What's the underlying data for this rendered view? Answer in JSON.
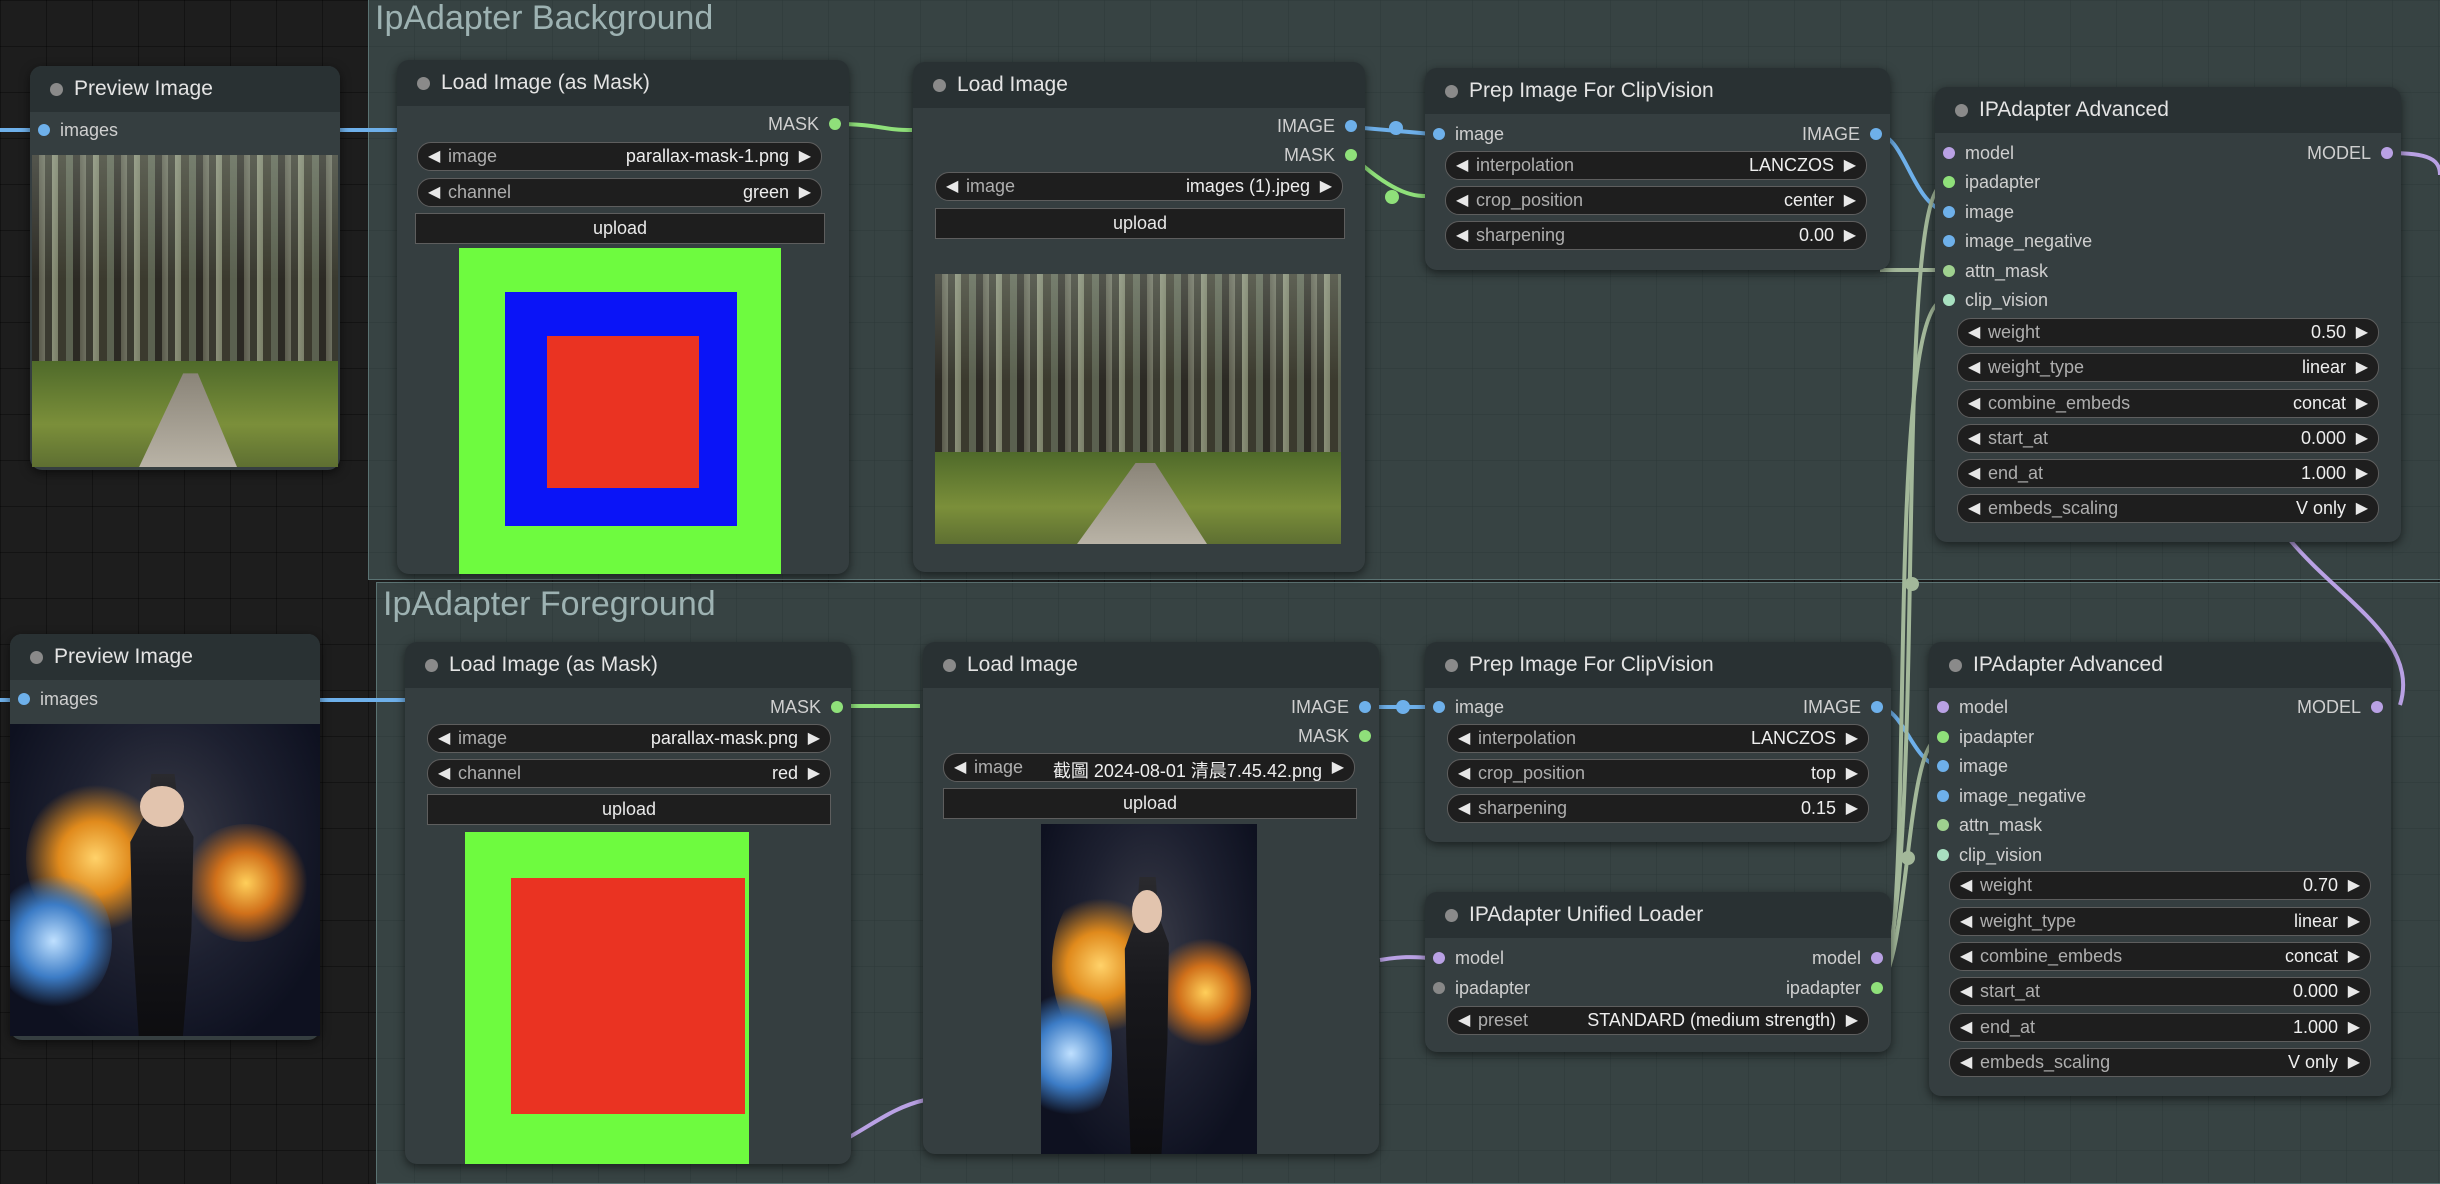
{
  "colors": {
    "image_wire": "#6eb0ea",
    "mask_wire": "#8fe07a",
    "model_wire": "#b9a1e4",
    "clip_wire": "#a3b89a"
  },
  "groups": {
    "background": {
      "title": "IpAdapter Background"
    },
    "foreground": {
      "title": "IpAdapter Foreground"
    }
  },
  "nodes": {
    "preview1": {
      "title": "Preview Image",
      "input": "images"
    },
    "mask1": {
      "title": "Load Image (as Mask)",
      "output": "MASK",
      "image_label": "image",
      "image_value": "parallax-mask-1.png",
      "channel_label": "channel",
      "channel_value": "green",
      "upload": "upload"
    },
    "load1": {
      "title": "Load Image",
      "out_image": "IMAGE",
      "out_mask": "MASK",
      "image_label": "image",
      "image_value": "images (1).jpeg",
      "upload": "upload"
    },
    "prep1": {
      "title": "Prep Image For ClipVision",
      "input": "image",
      "output": "IMAGE",
      "interp_label": "interpolation",
      "interp_value": "LANCZOS",
      "crop_label": "crop_position",
      "crop_value": "center",
      "sharp_label": "sharpening",
      "sharp_value": "0.00"
    },
    "ipa1": {
      "title": "IPAdapter Advanced",
      "output": "MODEL",
      "inputs": [
        "model",
        "ipadapter",
        "image",
        "image_negative",
        "attn_mask",
        "clip_vision"
      ],
      "widgets": [
        {
          "label": "weight",
          "value": "0.50"
        },
        {
          "label": "weight_type",
          "value": "linear"
        },
        {
          "label": "combine_embeds",
          "value": "concat"
        },
        {
          "label": "start_at",
          "value": "0.000"
        },
        {
          "label": "end_at",
          "value": "1.000"
        },
        {
          "label": "embeds_scaling",
          "value": "V only"
        }
      ]
    },
    "preview2": {
      "title": "Preview Image",
      "input": "images"
    },
    "mask2": {
      "title": "Load Image (as Mask)",
      "output": "MASK",
      "image_label": "image",
      "image_value": "parallax-mask.png",
      "channel_label": "channel",
      "channel_value": "red",
      "upload": "upload"
    },
    "load2": {
      "title": "Load Image",
      "out_image": "IMAGE",
      "out_mask": "MASK",
      "image_label": "image",
      "image_value": "截圖 2024-08-01 清晨7.45.42.png",
      "upload": "upload"
    },
    "prep2": {
      "title": "Prep Image For ClipVision",
      "input": "image",
      "output": "IMAGE",
      "interp_label": "interpolation",
      "interp_value": "LANCZOS",
      "crop_label": "crop_position",
      "crop_value": "top",
      "sharp_label": "sharpening",
      "sharp_value": "0.15"
    },
    "ipa2": {
      "title": "IPAdapter Advanced",
      "output": "MODEL",
      "inputs": [
        "model",
        "ipadapter",
        "image",
        "image_negative",
        "attn_mask",
        "clip_vision"
      ],
      "widgets": [
        {
          "label": "weight",
          "value": "0.70"
        },
        {
          "label": "weight_type",
          "value": "linear"
        },
        {
          "label": "combine_embeds",
          "value": "concat"
        },
        {
          "label": "start_at",
          "value": "0.000"
        },
        {
          "label": "end_at",
          "value": "1.000"
        },
        {
          "label": "embeds_scaling",
          "value": "V only"
        }
      ]
    },
    "loader": {
      "title": "IPAdapter Unified Loader",
      "in_model": "model",
      "in_ipadapter": "ipadapter",
      "out_model": "model",
      "out_ipadapter": "ipadapter",
      "preset_label": "preset",
      "preset_value": "STANDARD (medium strength)"
    }
  }
}
